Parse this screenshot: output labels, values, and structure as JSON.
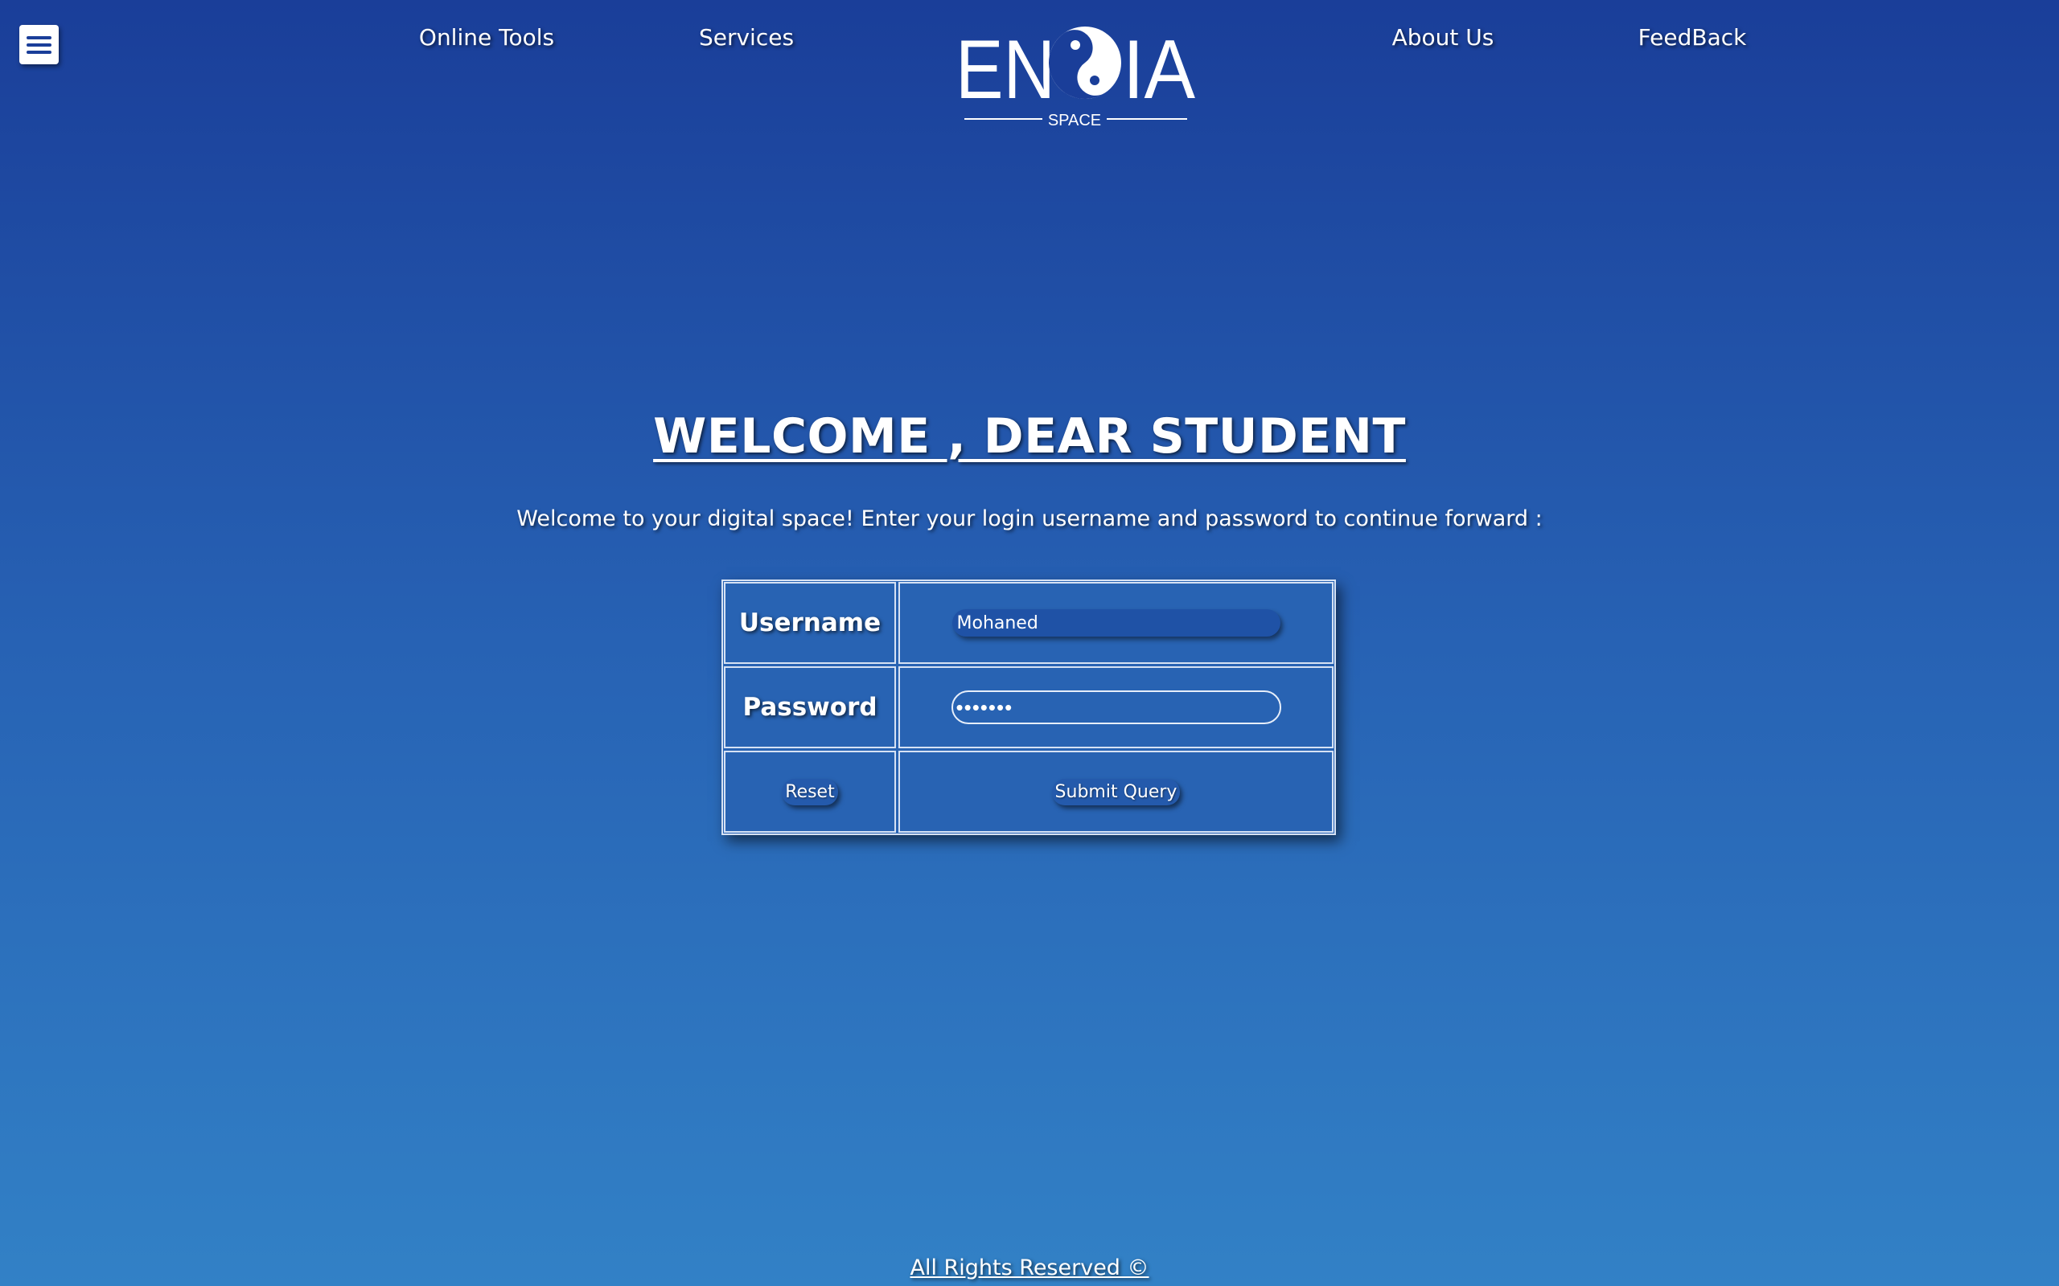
{
  "nav": {
    "menu_icon": "hamburger-icon",
    "items": [
      {
        "label": "Online Tools"
      },
      {
        "label": "Services"
      },
      {
        "label": "About Us"
      },
      {
        "label": "FeedBack"
      }
    ]
  },
  "logo": {
    "text": "ENOIA",
    "subtext": "SPACE"
  },
  "main": {
    "title": "WELCOME , DEAR STUDENT",
    "subtitle": "Welcome to your digital space! Enter your login username and password to continue forward :"
  },
  "form": {
    "username_label": "Username",
    "username_value": "Mohaned",
    "password_label": "Password",
    "password_value": "•••••••",
    "reset_label": "Reset",
    "submit_label": "Submit Query"
  },
  "footer": {
    "text": "All Rights Reserved ©"
  },
  "colors": {
    "background_top": "#1a3e99",
    "background_bottom": "#3281c6",
    "text": "#ffffff"
  }
}
